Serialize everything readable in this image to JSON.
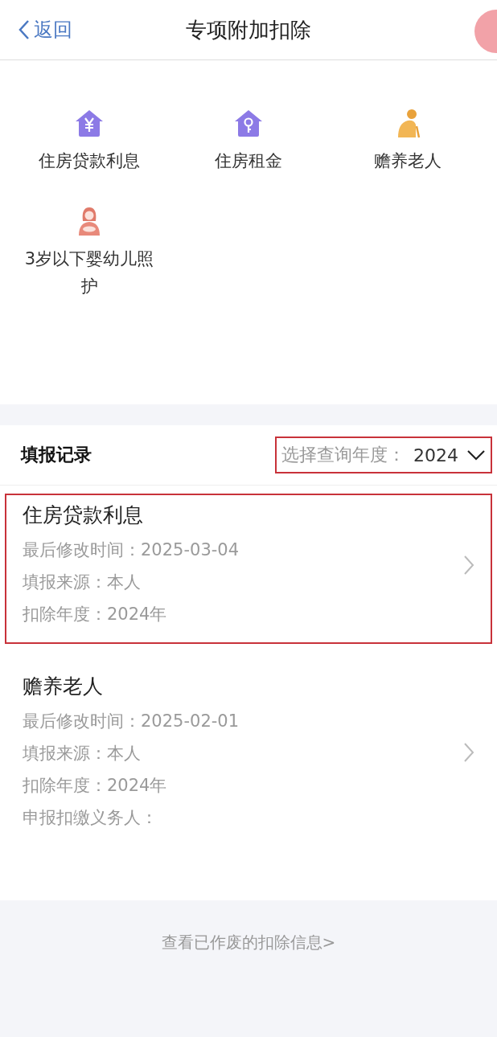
{
  "header": {
    "back": "返回",
    "title": "专项附加扣除"
  },
  "categories": [
    {
      "label": "住房贷款利息",
      "kind": "loan"
    },
    {
      "label": "住房租金",
      "kind": "rent"
    },
    {
      "label": "赡养老人",
      "kind": "elder"
    },
    {
      "label": "3岁以下婴幼儿照护",
      "kind": "infant"
    }
  ],
  "records_section": {
    "title": "填报记录",
    "year_label": "选择查询年度：",
    "year": "2024",
    "year_highlighted": true
  },
  "records": [
    {
      "title": "住房贷款利息",
      "highlighted": true,
      "lines": [
        "最后修改时间：2025-03-04",
        "填报来源：本人",
        "扣除年度：2024年"
      ]
    },
    {
      "title": "赡养老人",
      "highlighted": false,
      "lines": [
        "最后修改时间：2025-02-01",
        "填报来源：本人",
        "扣除年度：2024年",
        "申报扣缴义务人："
      ]
    }
  ],
  "footer_link": "查看已作废的扣除信息>"
}
